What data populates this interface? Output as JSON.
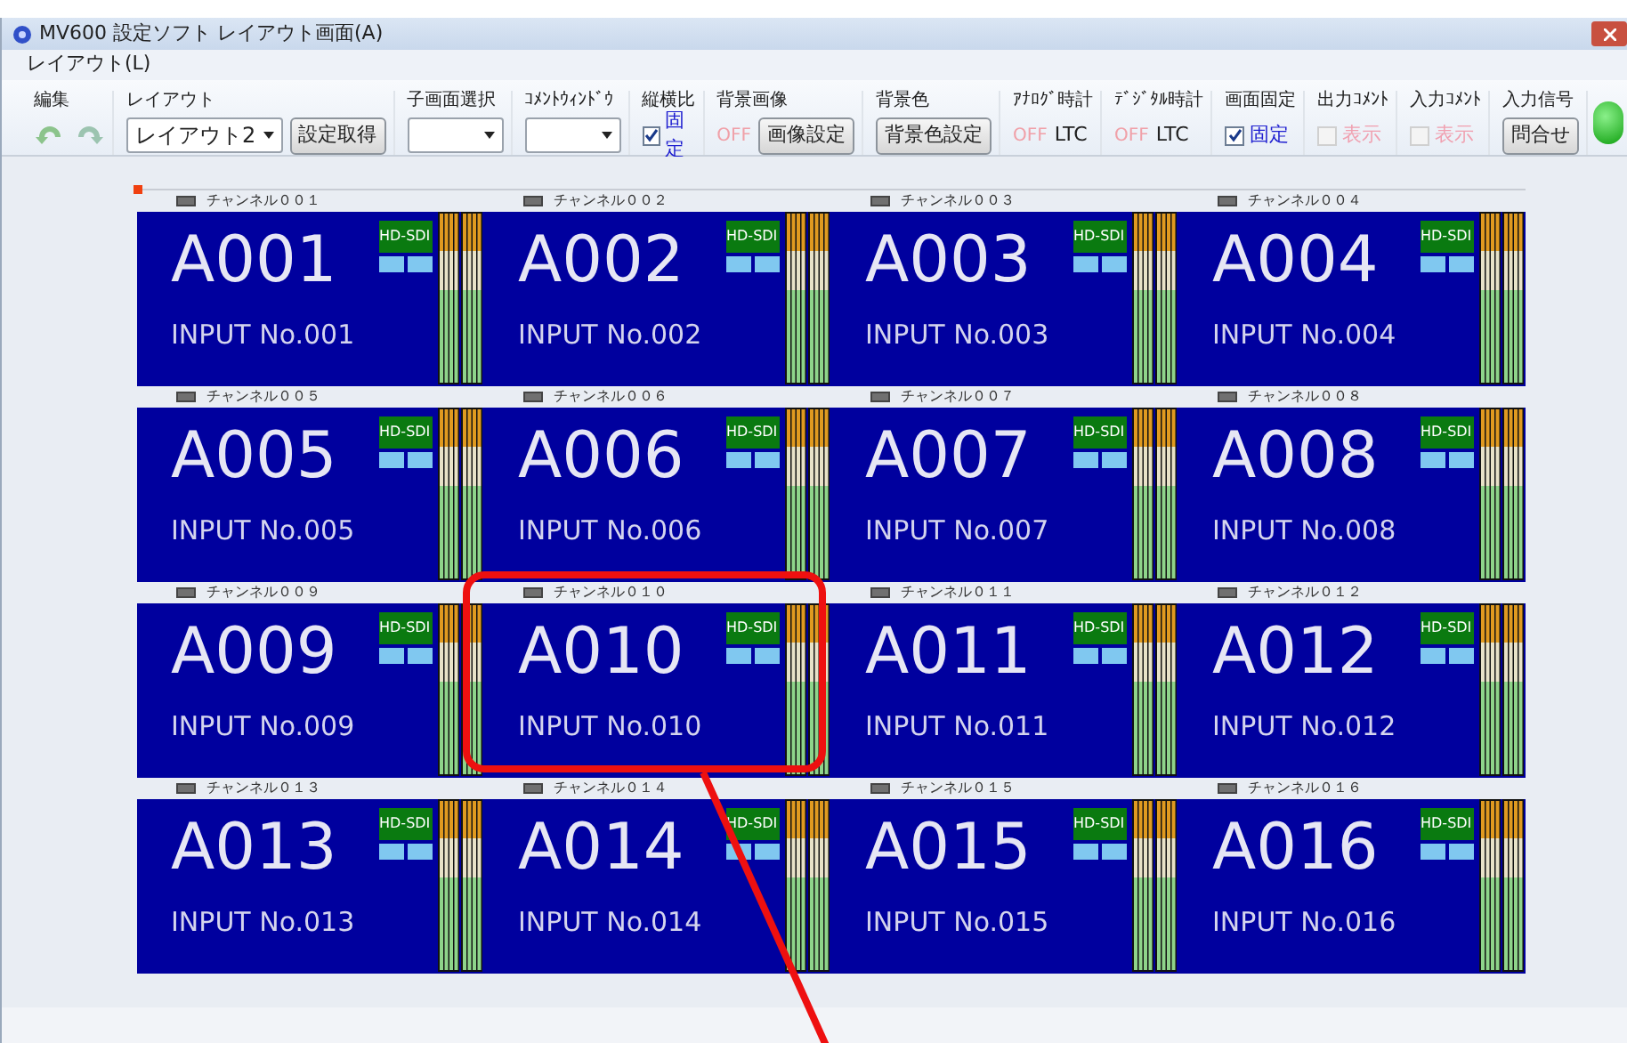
{
  "window": {
    "title": "MV600 設定ソフト レイアウト画面(A)"
  },
  "menu": [
    "レイアウト(L)"
  ],
  "toolbar": [
    {
      "label": "編集",
      "items": [
        {
          "kind": "undo"
        },
        {
          "kind": "redo"
        }
      ]
    },
    {
      "label": "レイアウト",
      "items": [
        {
          "kind": "select",
          "value": "レイアウト2"
        },
        {
          "kind": "button",
          "label": "設定取得"
        }
      ]
    },
    {
      "label": "子画面選択",
      "items": [
        {
          "kind": "select"
        }
      ]
    },
    {
      "label": "ｺﾒﾝﾄｳｨﾝﾄﾞｳ",
      "items": [
        {
          "kind": "select"
        }
      ]
    },
    {
      "label": "縦横比",
      "items": [
        {
          "kind": "checkbox",
          "label": "固定",
          "checked": true
        }
      ]
    },
    {
      "label": "背景画像",
      "items": [
        {
          "kind": "toggle",
          "label": "OFF"
        },
        {
          "kind": "button",
          "label": "画像設定"
        }
      ]
    },
    {
      "label": "背景色",
      "items": [
        {
          "kind": "button",
          "label": "背景色設定"
        }
      ]
    },
    {
      "label": "ｱﾅﾛｸﾞ時計",
      "items": [
        {
          "kind": "toggle",
          "label": "OFF"
        },
        {
          "kind": "text",
          "label": "LTC"
        }
      ]
    },
    {
      "label": "ﾃﾞｼﾞﾀﾙ時計",
      "items": [
        {
          "kind": "toggle",
          "label": "OFF"
        },
        {
          "kind": "text",
          "label": "LTC"
        }
      ]
    },
    {
      "label": "画面固定",
      "items": [
        {
          "kind": "checkbox",
          "label": "固定",
          "checked": true
        }
      ]
    },
    {
      "label": "出力ｺﾒﾝﾄ",
      "items": [
        {
          "kind": "checkbox",
          "label": "表示",
          "checked": false
        }
      ]
    },
    {
      "label": "入力ｺﾒﾝﾄ",
      "items": [
        {
          "kind": "checkbox",
          "label": "表示",
          "checked": false
        }
      ]
    },
    {
      "label": "入力信号",
      "items": [
        {
          "kind": "button",
          "label": "問合せ"
        }
      ]
    }
  ],
  "status_light": {
    "on": true
  },
  "channels": [
    {
      "caption": "チャンネル００１",
      "name": "A001",
      "input": "INPUT No.001",
      "badge": "HD-SDI",
      "highlighted": false
    },
    {
      "caption": "チャンネル００２",
      "name": "A002",
      "input": "INPUT No.002",
      "badge": "HD-SDI",
      "highlighted": false
    },
    {
      "caption": "チャンネル００３",
      "name": "A003",
      "input": "INPUT No.003",
      "badge": "HD-SDI",
      "highlighted": false
    },
    {
      "caption": "チャンネル００４",
      "name": "A004",
      "input": "INPUT No.004",
      "badge": "HD-SDI",
      "highlighted": false
    },
    {
      "caption": "チャンネル００５",
      "name": "A005",
      "input": "INPUT No.005",
      "badge": "HD-SDI",
      "highlighted": false
    },
    {
      "caption": "チャンネル００６",
      "name": "A006",
      "input": "INPUT No.006",
      "badge": "HD-SDI",
      "highlighted": false
    },
    {
      "caption": "チャンネル００７",
      "name": "A007",
      "input": "INPUT No.007",
      "badge": "HD-SDI",
      "highlighted": false
    },
    {
      "caption": "チャンネル００８",
      "name": "A008",
      "input": "INPUT No.008",
      "badge": "HD-SDI",
      "highlighted": false
    },
    {
      "caption": "チャンネル００９",
      "name": "A009",
      "input": "INPUT No.009",
      "badge": "HD-SDI",
      "highlighted": false
    },
    {
      "caption": "チャンネル０１０",
      "name": "A010",
      "input": "INPUT No.010",
      "badge": "HD-SDI",
      "highlighted": true
    },
    {
      "caption": "チャンネル０１１",
      "name": "A011",
      "input": "INPUT No.011",
      "badge": "HD-SDI",
      "highlighted": false
    },
    {
      "caption": "チャンネル０１２",
      "name": "A012",
      "input": "INPUT No.012",
      "badge": "HD-SDI",
      "highlighted": false
    },
    {
      "caption": "チャンネル０１３",
      "name": "A013",
      "input": "INPUT No.013",
      "badge": "HD-SDI",
      "highlighted": false
    },
    {
      "caption": "チャンネル０１４",
      "name": "A014",
      "input": "INPUT No.014",
      "badge": "HD-SDI",
      "highlighted": false
    },
    {
      "caption": "チャンネル０１５",
      "name": "A015",
      "input": "INPUT No.015",
      "badge": "HD-SDI",
      "highlighted": false
    },
    {
      "caption": "チャンネル０１６",
      "name": "A016",
      "input": "INPUT No.016",
      "badge": "HD-SDI",
      "highlighted": false
    }
  ]
}
